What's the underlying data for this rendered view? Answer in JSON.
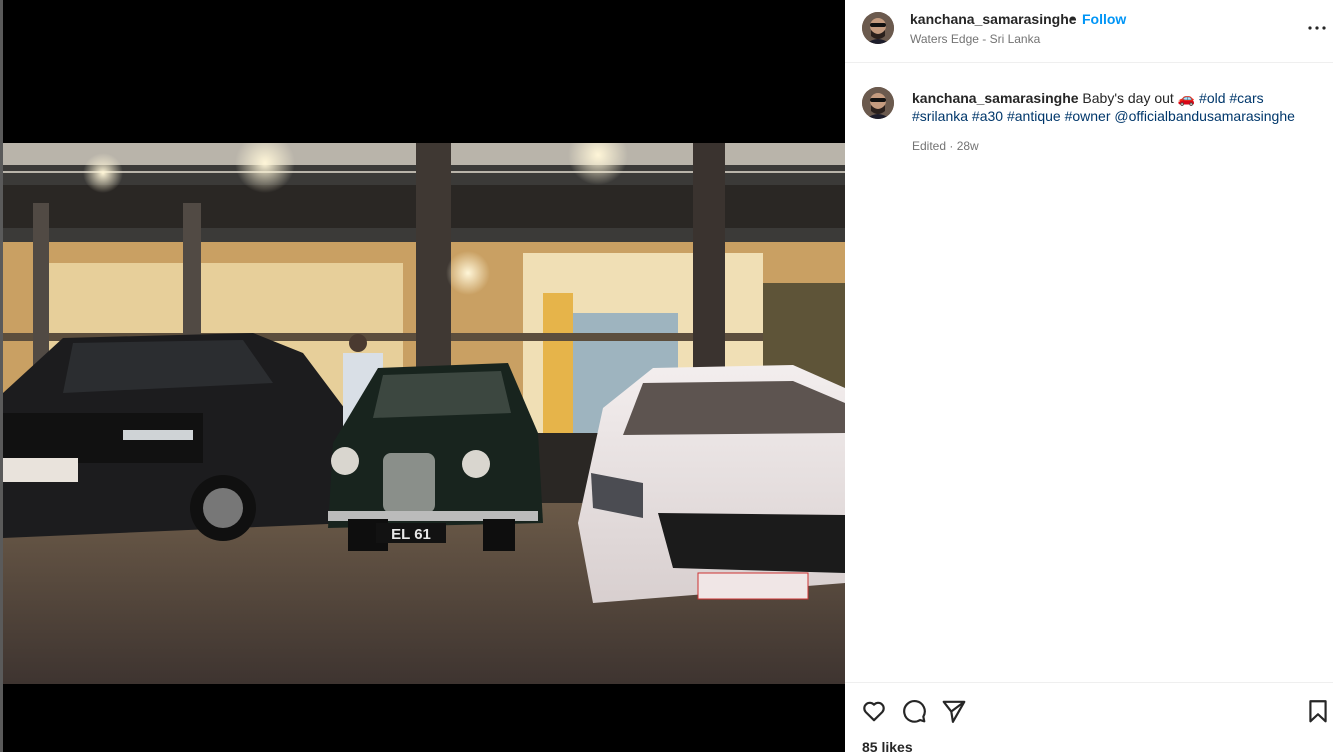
{
  "post": {
    "username": "kanchana_samarasinghe",
    "separator": "•",
    "follow_label": "Follow",
    "location": "Waters Edge - Sri Lanka"
  },
  "caption": {
    "username": "kanchana_samarasinghe",
    "text": "Baby's day out 🚗 ",
    "hashtags": [
      "#old",
      "#cars",
      "#srilanka",
      "#a30",
      "#antique",
      "#owner"
    ],
    "mention": "@officialbandusamarasinghe",
    "meta": "Edited · 28w"
  },
  "actions": {
    "likes": "85 likes"
  },
  "photo": {
    "plate_text": "EL 61"
  },
  "icons": {
    "like": "heart-icon",
    "comment": "comment-icon",
    "share": "send-icon",
    "save": "bookmark-icon",
    "more": "more-options-icon"
  },
  "colors": {
    "accent": "#0095f6",
    "link": "#00376b",
    "muted": "#737373"
  }
}
